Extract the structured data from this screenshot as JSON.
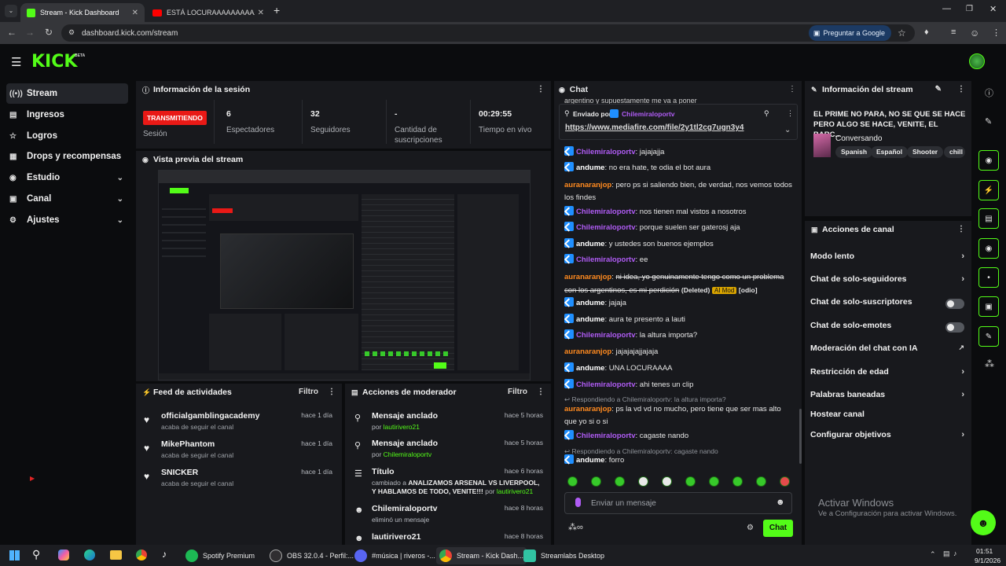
{
  "browser": {
    "tabs": [
      {
        "title": "Stream - Kick Dashboard",
        "active": true
      },
      {
        "title": "ESTÁ LOCURAAAAAAAAAAAAA",
        "active": false
      }
    ],
    "url": "dashboard.kick.com/stream",
    "ask_google": "Preguntar a Google",
    "accent": "#53fc18"
  },
  "app": {
    "logo": "KICK",
    "beta": "BETA"
  },
  "sidebar": {
    "items": [
      {
        "label": "Stream",
        "icon": "broadcast-icon",
        "active": true
      },
      {
        "label": "Ingresos",
        "icon": "chart-icon"
      },
      {
        "label": "Logros",
        "icon": "trophy-icon"
      },
      {
        "label": "Drops y recompensas",
        "icon": "gift-icon"
      },
      {
        "label": "Estudio",
        "icon": "studio-icon",
        "expandable": true
      },
      {
        "label": "Canal",
        "icon": "channel-icon",
        "expandable": true
      },
      {
        "label": "Ajustes",
        "icon": "gear-icon",
        "expandable": true
      }
    ]
  },
  "session": {
    "title": "Información de la sesión",
    "status_badge": "TRANSMITIENDO",
    "status_label": "Sesión",
    "stats": [
      {
        "value": "6",
        "label": "Espectadores"
      },
      {
        "value": "32",
        "label": "Seguidores"
      },
      {
        "value": "-",
        "label": "Cantidad de suscripciones"
      },
      {
        "value": "00:29:55",
        "label": "Tiempo en vivo"
      }
    ]
  },
  "preview": {
    "title": "Vista previa del stream"
  },
  "feed": {
    "title": "Feed de actividades",
    "filter": "Filtro",
    "items": [
      {
        "name": "officialgamblingacademy",
        "sub": "acaba de seguir el canal",
        "time": "hace 1 día"
      },
      {
        "name": "MikePhantom",
        "sub": "acaba de seguir el canal",
        "time": "hace 1 día"
      },
      {
        "name": "SNICKER",
        "sub": "acaba de seguir el canal",
        "time": "hace 1 día"
      }
    ]
  },
  "mod": {
    "title": "Acciones de moderador",
    "filter": "Filtro",
    "items": [
      {
        "name": "Mensaje anclado",
        "by_prefix": "por",
        "by": "lautirivero21",
        "time": "hace 5 horas"
      },
      {
        "name": "Mensaje anclado",
        "by_prefix": "por",
        "by": "Chilemiraloportv",
        "time": "hace 5 horas"
      },
      {
        "name": "Título",
        "sub_prefix": "cambiado a",
        "sub_title": "ANALIZAMOS ARSENAL VS LIVERPOOL, Y HABLAMOS DE TODO, VENITE!!!",
        "by_prefix": "por",
        "by": "lautirivero21",
        "time": "hace 6 horas"
      },
      {
        "name": "Chilemiraloportv",
        "sub": "eliminó un mensaje",
        "time": "hace 8 horas"
      },
      {
        "name": "lautirivero21",
        "time": "hace 8 horas"
      }
    ]
  },
  "chat": {
    "title": "Chat",
    "top_cut": "argentino y supuestamente me va a poner",
    "pinned": {
      "label": "Enviado por",
      "user": "Chilemiraloportv",
      "link": "https://www.mediafire.com/file/2y1tl2cg7ugn3y4"
    },
    "messages": [
      {
        "user": "Chilemiraloportv",
        "color": "#b05cf5",
        "badge": true,
        "text": "jajajajja"
      },
      {
        "user": "andume",
        "color": "#ffffff",
        "badge": true,
        "text": "no era hate, te odia el bot aura"
      },
      {
        "user": "auranaranjop",
        "color": "#ff8a1f",
        "badge": false,
        "text": "pero ps si saliendo bien, de verdad, nos vemos todos los findes"
      },
      {
        "user": "Chilemiraloportv",
        "color": "#b05cf5",
        "badge": true,
        "text": "nos tienen mal vistos a nosotros"
      },
      {
        "user": "Chilemiraloportv",
        "color": "#b05cf5",
        "badge": true,
        "text": "porque suelen ser gaterosj aja"
      },
      {
        "user": "andume",
        "color": "#ffffff",
        "badge": true,
        "text": "y ustedes son buenos ejemplos"
      },
      {
        "user": "Chilemiraloportv",
        "color": "#b05cf5",
        "badge": true,
        "text": "ee"
      },
      {
        "user": "auranaranjop",
        "color": "#ff8a1f",
        "badge": false,
        "text": "ni idea, yo genuinamente tengo como un problema con los argentinos, es mi perdición",
        "deleted": "(Deleted)",
        "mod_tag": "AI Mod",
        "extra": "[odio]"
      },
      {
        "user": "andume",
        "color": "#ffffff",
        "badge": true,
        "text": "jajaja"
      },
      {
        "user": "andume",
        "color": "#ffffff",
        "badge": true,
        "text": "aura te presento a lauti"
      },
      {
        "user": "Chilemiraloportv",
        "color": "#b05cf5",
        "badge": true,
        "text": "la altura importa?"
      },
      {
        "user": "auranaranjop",
        "color": "#ff8a1f",
        "badge": false,
        "text": "jajajajajjajaja"
      },
      {
        "user": "andume",
        "color": "#ffffff",
        "badge": true,
        "text": "UNA LOCURAAAA"
      },
      {
        "user": "Chilemiraloportv",
        "color": "#b05cf5",
        "badge": true,
        "text": "ahi tenes un clip"
      },
      {
        "reply": "Respondiendo a Chilemiraloportv: la altura importa?",
        "user": "auranaranjop",
        "color": "#ff8a1f",
        "badge": false,
        "text": "ps la vd vd no mucho, pero tiene que ser mas alto que yo si o si"
      },
      {
        "user": "Chilemiraloportv",
        "color": "#b05cf5",
        "badge": true,
        "text": "cagaste nando"
      },
      {
        "reply": "Respondiendo a Chilemiraloportv: cagaste nando",
        "user": "andume",
        "color": "#ffffff",
        "badge": true,
        "text": "forro"
      }
    ],
    "input_placeholder": "Enviar un mensaje",
    "send": "Chat"
  },
  "stream_info": {
    "title": "Información del stream",
    "stream_title": "EL PRIME NO PARA, NO SE QUE SE HACE PERO ALGO SE HACE, VENITE, EL BARC...",
    "category": "Conversando",
    "tags": [
      "Spanish",
      "Español",
      "Shooter",
      "chill"
    ]
  },
  "channel_actions": {
    "title": "Acciones de canal",
    "items": [
      {
        "label": "Modo lento",
        "control": "chevron"
      },
      {
        "label": "Chat de solo-seguidores",
        "control": "chevron"
      },
      {
        "label": "Chat de solo-suscriptores",
        "control": "toggle",
        "on": false
      },
      {
        "label": "Chat de solo-emotes",
        "control": "toggle",
        "on": false
      },
      {
        "label": "Moderación del chat con IA",
        "control": "external"
      },
      {
        "label": "Restricción de edad",
        "control": "chevron"
      },
      {
        "label": "Palabras baneadas",
        "control": "chevron"
      },
      {
        "label": "Hostear canal",
        "control": "none"
      },
      {
        "label": "Configurar objetivos",
        "control": "chevron"
      }
    ]
  },
  "windows": {
    "activate_title": "Activar Windows",
    "activate_sub": "Ve a Configuración para activar Windows.",
    "taskbar": [
      {
        "label": "Spotify Premium",
        "color": "#1db954"
      },
      {
        "label": "OBS 32.0.4 - Perfil:...",
        "color": "#302e31"
      },
      {
        "label": "#música | riveros -...",
        "color": "#5865f2"
      },
      {
        "label": "Stream - Kick Dash...",
        "color": "#53fc18"
      },
      {
        "label": "Streamlabs Desktop",
        "color": "#31c3a2"
      }
    ],
    "time": "01:51",
    "date": "9/1/2026"
  }
}
